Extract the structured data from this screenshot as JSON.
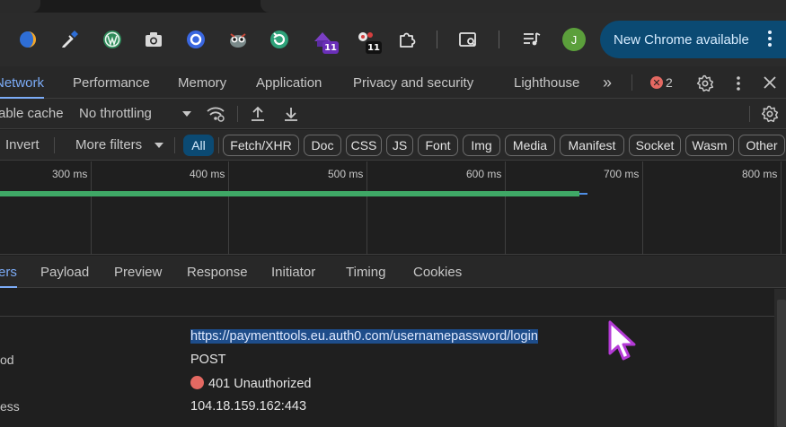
{
  "browser": {
    "extensions": [
      {
        "name": "half-moon-extension-icon"
      },
      {
        "name": "color-dropper-extension-icon"
      },
      {
        "name": "wordpress-extension-icon"
      },
      {
        "name": "camera-extension-icon"
      },
      {
        "name": "blue-circle-extension-icon"
      },
      {
        "name": "owl-extension-icon"
      },
      {
        "name": "refresh-extension-icon"
      },
      {
        "name": "purple-extension-icon",
        "badge": "11"
      },
      {
        "name": "game-extension-icon",
        "badge": "11"
      },
      {
        "name": "puzzle-icon"
      }
    ],
    "avatar_initial": "J",
    "update_label": "New Chrome available"
  },
  "devtools": {
    "panel_tabs": [
      "Network",
      "Performance",
      "Memory",
      "Application",
      "Privacy and security",
      "Lighthouse"
    ],
    "error_count": "2",
    "throttle": {
      "cache_label": "able cache",
      "throttling": "No throttling"
    },
    "filters": {
      "invert_label": "Invert",
      "more_filters_label": "More filters",
      "types": [
        "All",
        "Fetch/XHR",
        "Doc",
        "CSS",
        "JS",
        "Font",
        "Img",
        "Media",
        "Manifest",
        "Socket",
        "Wasm",
        "Other"
      ]
    },
    "timeline": {
      "ticks": [
        "300 ms",
        "400 ms",
        "500 ms",
        "600 ms",
        "700 ms",
        "800 ms"
      ]
    },
    "detail_tabs": [
      "ers",
      "Payload",
      "Preview",
      "Response",
      "Initiator",
      "Timing",
      "Cookies"
    ],
    "general": {
      "rows": [
        {
          "key": "",
          "value": "https://paymenttools.eu.auth0.com/usernamepassword/login"
        },
        {
          "key": "od",
          "value": "POST"
        },
        {
          "key": "",
          "value": "401 Unauthorized"
        },
        {
          "key": "ess",
          "value": "104.18.159.162:443"
        }
      ]
    }
  },
  "colors": {
    "accent": "#7cacf8",
    "status_error": "#e46962",
    "timeline_bar": "#3fa866",
    "update_pill": "#0b4a73"
  }
}
